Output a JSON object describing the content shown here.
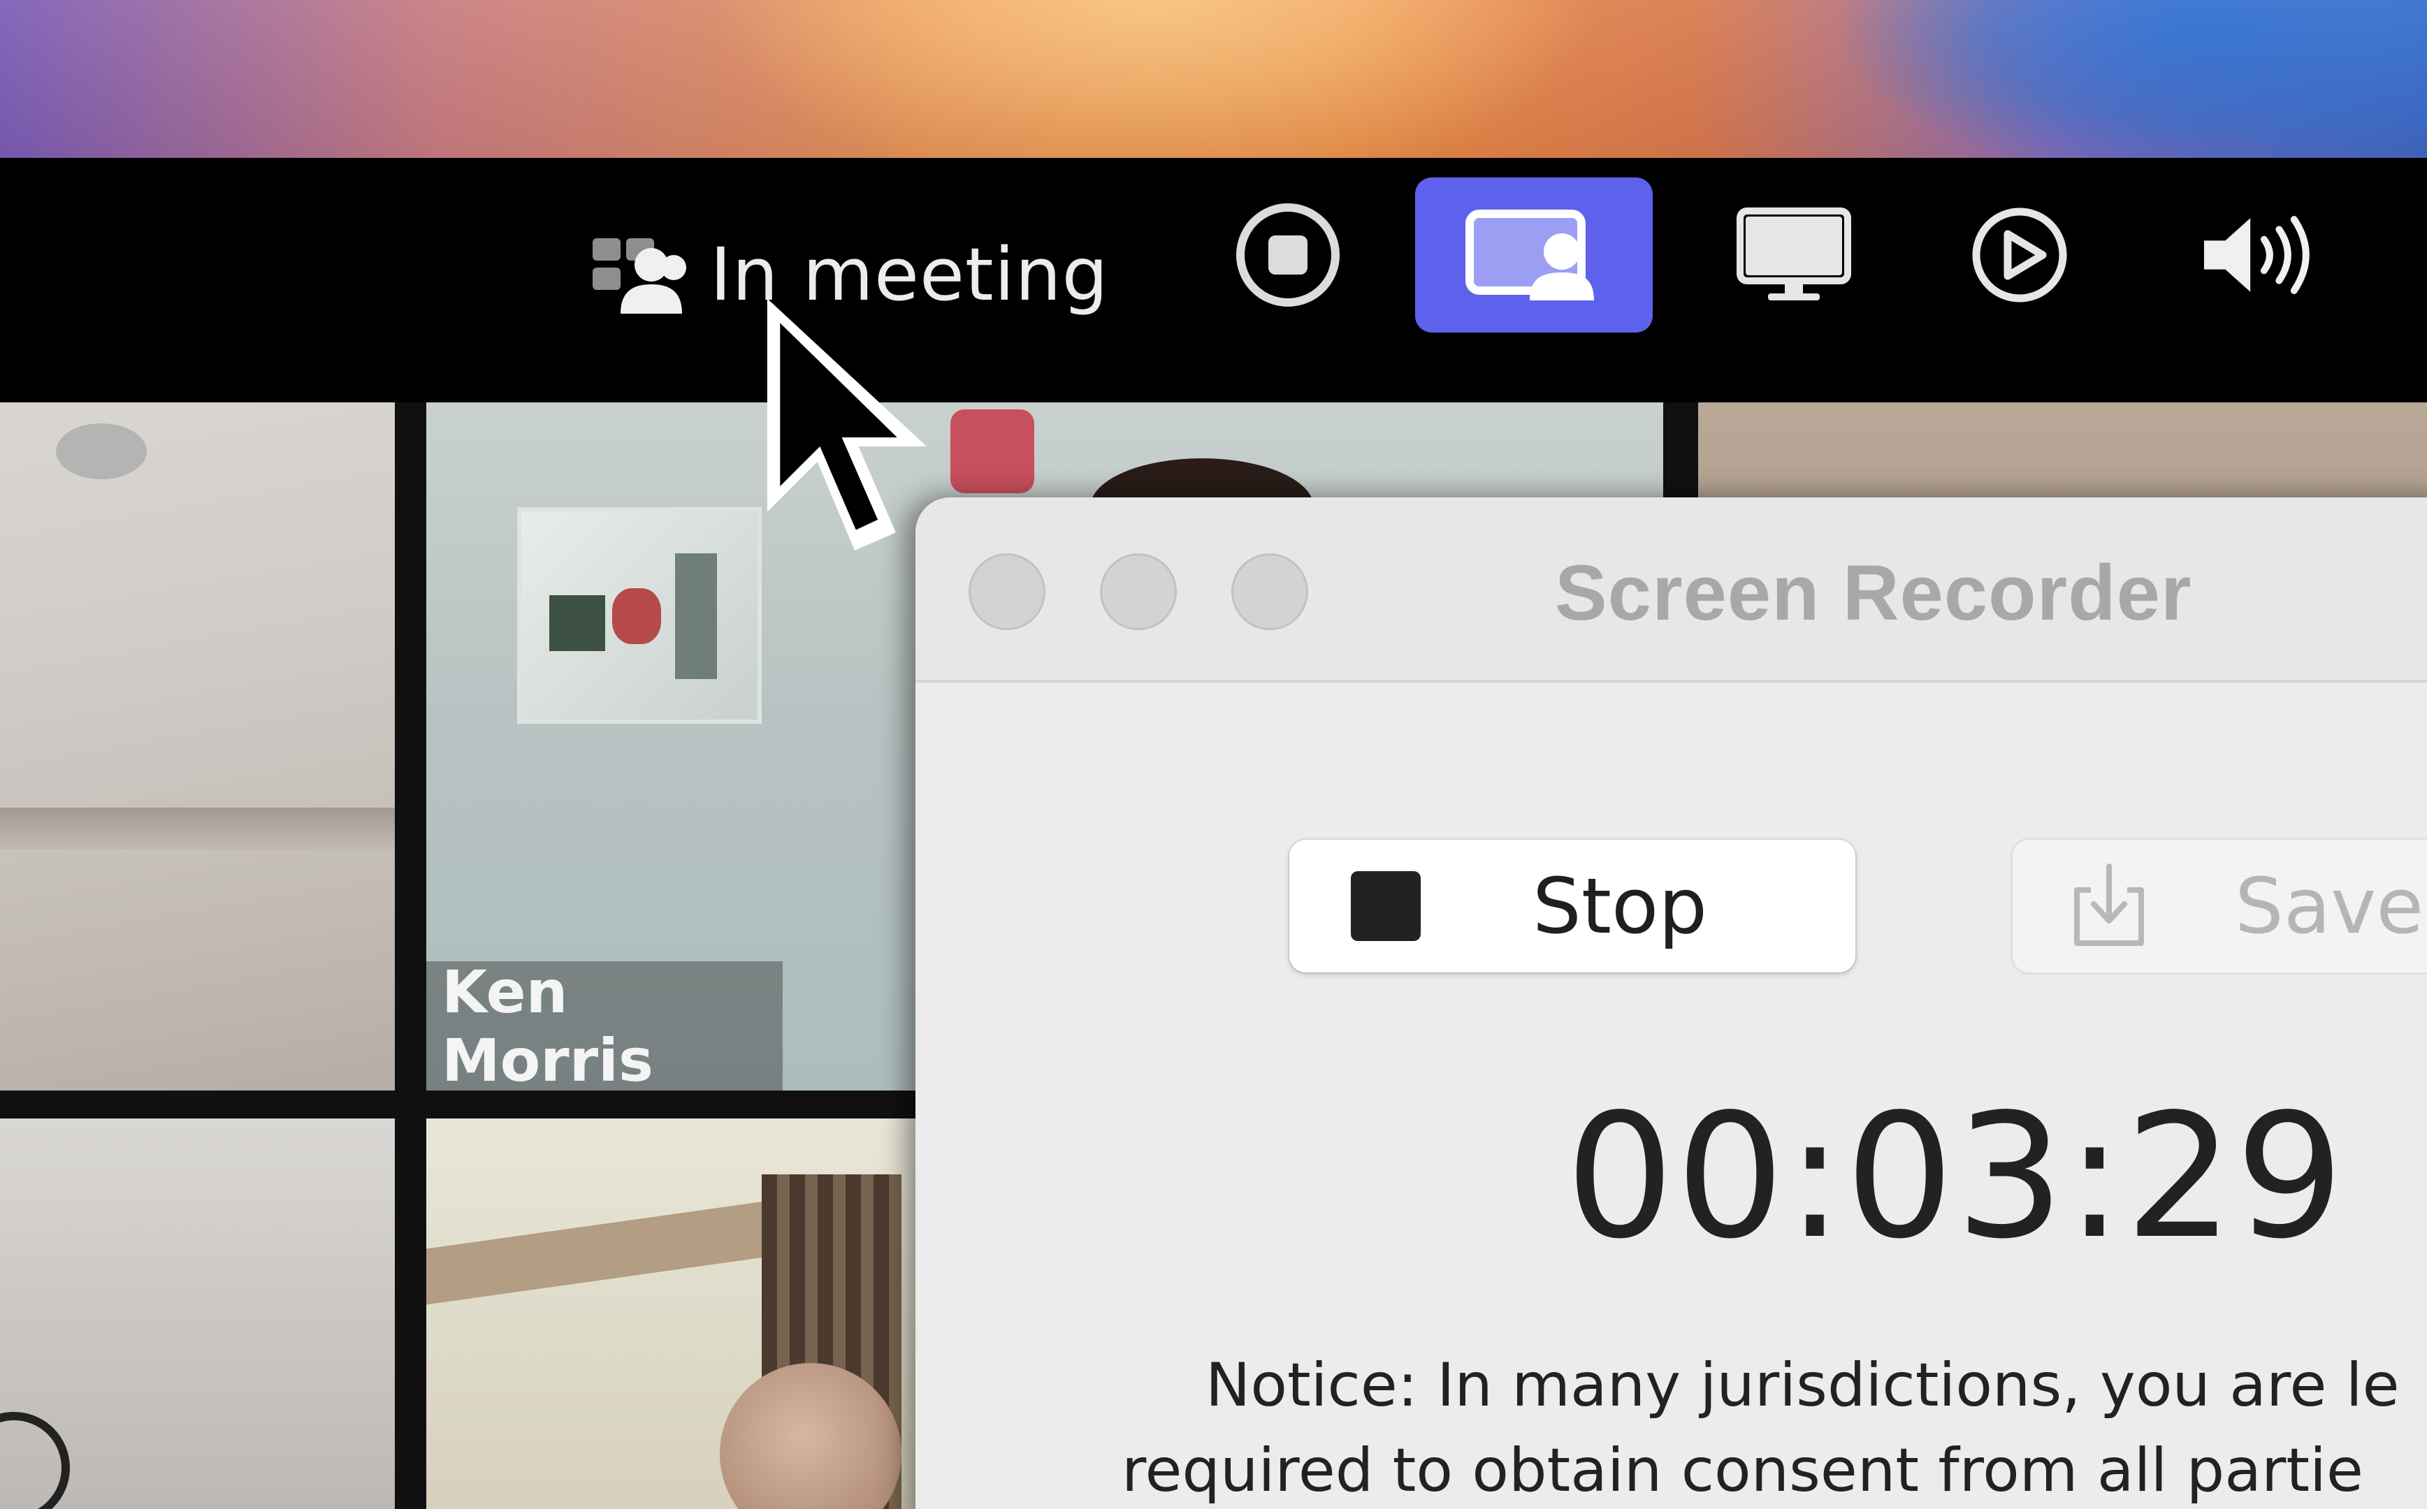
{
  "menubar": {
    "status_label": "In meeting",
    "tray_icons": [
      "meeting-status-icon",
      "stop-record-icon",
      "screen-share-icon",
      "display-icon",
      "play-icon",
      "volume-icon"
    ],
    "active_color": "#5e61ec"
  },
  "meeting": {
    "participant_name": "Ken Morris"
  },
  "recorder": {
    "title": "Screen Recorder",
    "stop_label": "Stop",
    "save_label": "Save",
    "elapsed": "00:03:29",
    "notice_line1": "Notice: In many jurisdictions, you are le",
    "notice_line2": "required to obtain consent from all partie"
  }
}
